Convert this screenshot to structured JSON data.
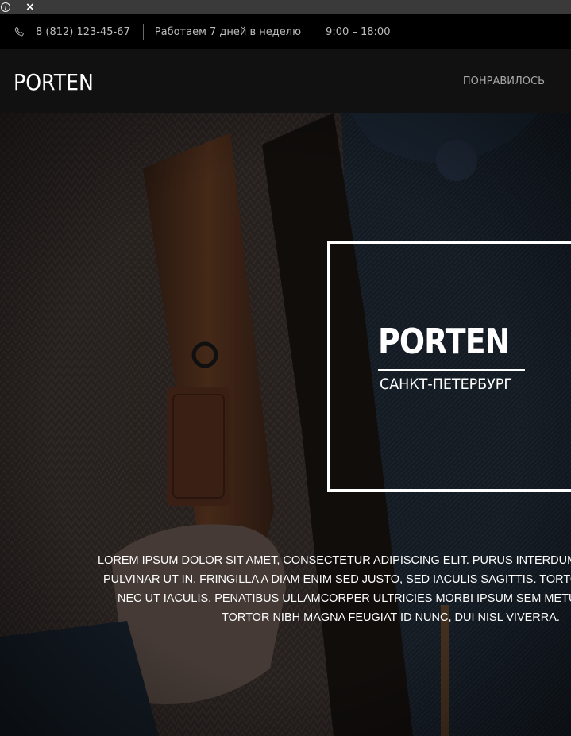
{
  "browser": {
    "info_icon": "info-icon",
    "close_symbol": "×"
  },
  "topbar": {
    "phone_icon": "phone-icon",
    "phone": "8 (812) 123-45-67",
    "hours_label": "Работаем 7 дней в неделю",
    "hours": "9:00 – 18:00"
  },
  "navbar": {
    "logo": "PORTEN",
    "link": "ПОНРАВИЛОСЬ"
  },
  "hero": {
    "brand": "PORTEN",
    "city": "САНКТ-ПЕТЕРБУРГ",
    "text_lines": [
      "LOREM IPSUM DOLOR SIT AMET, CONSECTETUR ADIPISCING ELIT. PURUS INTERDUM PU",
      "PULVINAR UT IN. FRINGILLA A DIAM ENIM SED JUSTO, SED IACULIS SAGITTIS. TORTOR",
      "NEC UT IACULIS. PENATIBUS ULLAMCORPER ULTRICIES MORBI IPSUM SEM METUS",
      "TORTOR NIBH MAGNA FEUGIAT ID NUNC, DUI NISL VIVERRA."
    ]
  }
}
